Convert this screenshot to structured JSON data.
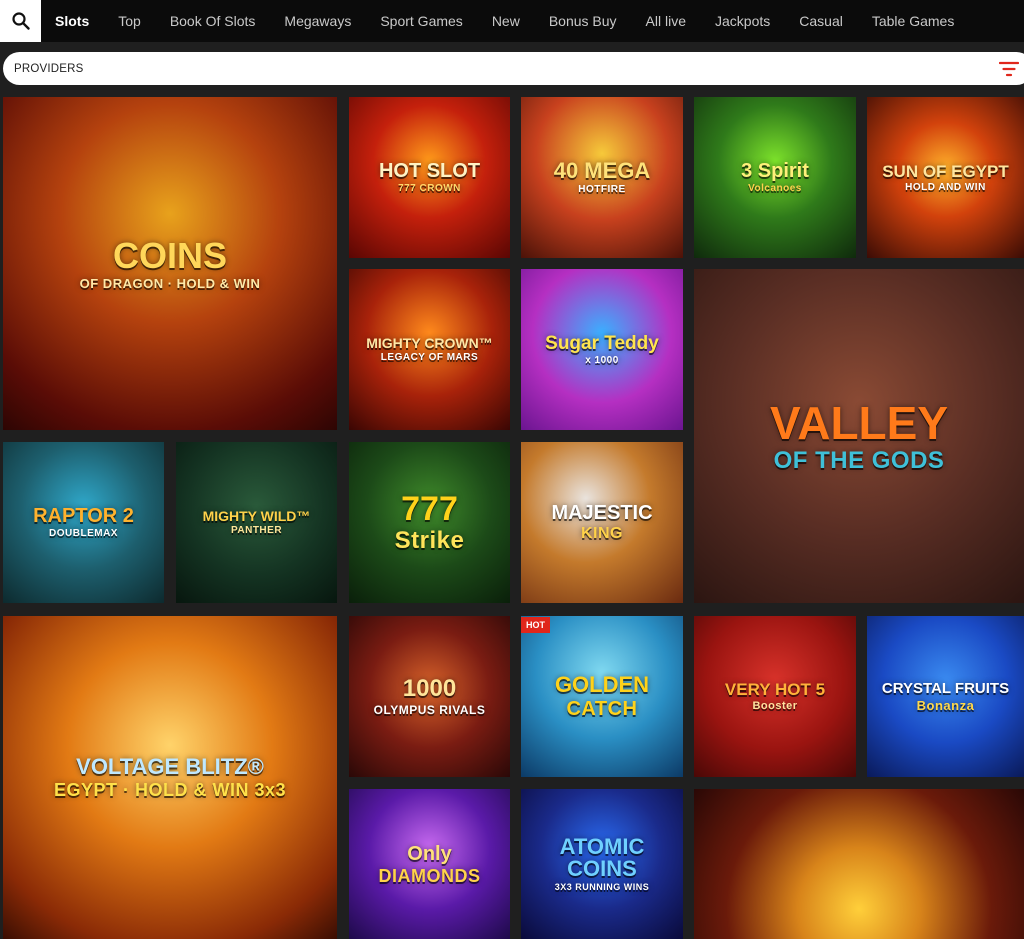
{
  "nav": {
    "tabs": [
      {
        "label": "Slots",
        "active": true
      },
      {
        "label": "Top"
      },
      {
        "label": "Book Of Slots"
      },
      {
        "label": "Megaways"
      },
      {
        "label": "Sport Games"
      },
      {
        "label": "New"
      },
      {
        "label": "Bonus Buy"
      },
      {
        "label": "All live"
      },
      {
        "label": "Jackpots"
      },
      {
        "label": "Casual"
      },
      {
        "label": "Table Games"
      }
    ]
  },
  "filter": {
    "providers_label": "PROVIDERS",
    "icon": "filter-icon",
    "accent": "#e0261b"
  },
  "games": [
    {
      "title": "COINS",
      "sub": "OF DRAGON · HOLD & WIN"
    },
    {
      "title": "HOT SLOT",
      "sub": "777 CROWN"
    },
    {
      "title": "40 MEGA",
      "sub": "HOTFIRE"
    },
    {
      "title": "3 Spirit",
      "sub": "Volcanoes"
    },
    {
      "title": "SUN OF EGYPT",
      "sub": "HOLD AND WIN"
    },
    {
      "title": "MIGHTY CROWN™",
      "sub": "LEGACY OF MARS"
    },
    {
      "title": "Sugar Teddy",
      "sub": "x 1000"
    },
    {
      "title": "VALLEY",
      "sub": "OF THE GODS"
    },
    {
      "title": "RAPTOR 2",
      "sub": "DOUBLEMAX"
    },
    {
      "title": "MIGHTY WILD™",
      "sub": "PANTHER"
    },
    {
      "title": "777",
      "sub": "Strike"
    },
    {
      "title": "MAJESTIC",
      "sub": "KING"
    },
    {
      "title": "VOLTAGE BLITZ®",
      "sub": "EGYPT · HOLD & WIN 3x3"
    },
    {
      "title": "1000",
      "sub": "OLYMPUS RIVALS"
    },
    {
      "title": "GOLDEN",
      "sub": "CATCH"
    },
    {
      "title": "VERY HOT 5",
      "sub": "Booster"
    },
    {
      "title": "CRYSTAL FRUITS",
      "sub": "Bonanza"
    },
    {
      "title": "Only",
      "sub": "DIAMONDS"
    },
    {
      "title": "ATOMIC COINS",
      "sub": "3X3 RUNNING WINS"
    },
    {
      "title": "",
      "sub": ""
    }
  ],
  "hot_badge": "HOT",
  "colors": {
    "nav_bg": "#0b0b0b",
    "page_bg": "#1f1f1f",
    "hot": "#e0261b"
  }
}
